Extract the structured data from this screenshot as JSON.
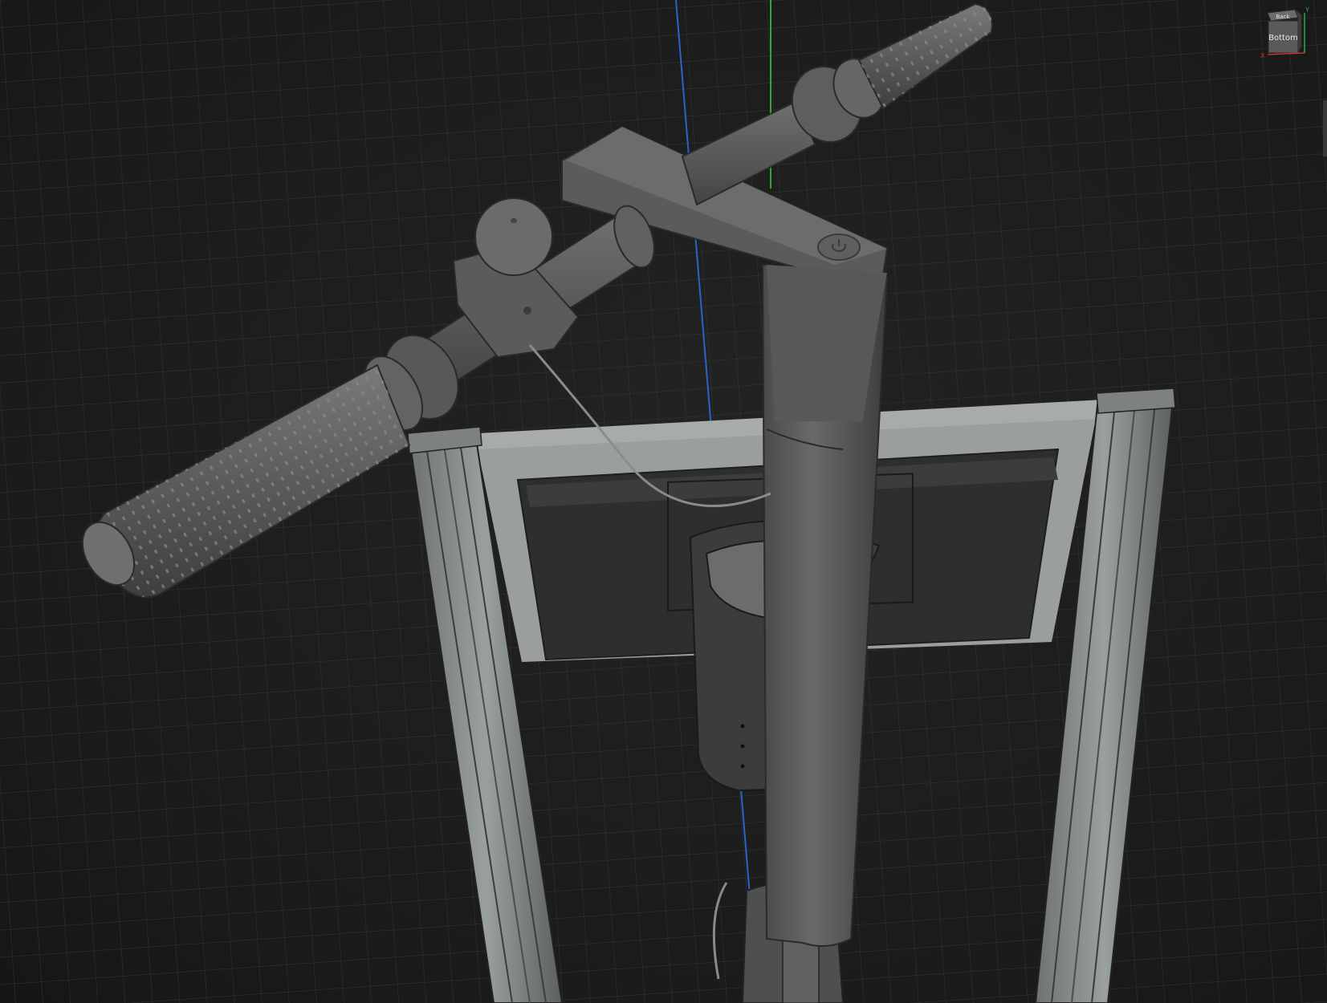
{
  "viewport": {
    "background": "#1c1c1c",
    "grid_color": "#3a3a3a",
    "axis_colors": {
      "y_axis": "#2fa83a",
      "z_axis": "#2a63c9",
      "x_axis": "#c83232"
    }
  },
  "viewcube": {
    "face_front": "Bottom",
    "face_top": "Back",
    "axis_y_label": "Y",
    "axis_x_label": "X"
  },
  "model": {
    "icons": [
      "handlebar",
      "grip-left",
      "grip-right",
      "bell",
      "stem",
      "power-button",
      "display-frame",
      "extrusion-rail",
      "cable"
    ]
  }
}
